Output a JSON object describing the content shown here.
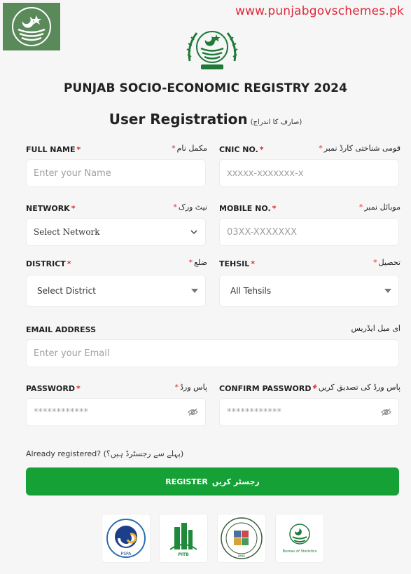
{
  "watermark": "www.punjabgovschemes.pk",
  "title": "PUNJAB SOCIO-ECONOMIC REGISTRY 2024",
  "subtitle": {
    "en": "User Registration",
    "ur": "(صارف کا اندراج)"
  },
  "fields": {
    "full_name": {
      "label": "FULL NAME",
      "label_ur": "مکمل نام",
      "placeholder": "Enter your Name"
    },
    "cnic": {
      "label": "CNIC NO.",
      "label_ur": "قومی شناختی کارڈ نمبر",
      "placeholder": "xxxxx-xxxxxxx-x"
    },
    "network": {
      "label": "NETWORK",
      "label_ur": "نیٹ ورک",
      "value": "Select Network"
    },
    "mobile": {
      "label": "MOBILE NO.",
      "label_ur": "موبائل نمبر",
      "placeholder": "03XX-XXXXXXX"
    },
    "district": {
      "label": "DISTRICT",
      "label_ur": "ضلع",
      "value": "Select District"
    },
    "tehsil": {
      "label": "TEHSIL",
      "label_ur": "تحصیل",
      "value": "All Tehsils"
    },
    "email": {
      "label": "EMAIL ADDRESS",
      "label_ur": "ای میل ایڈریس",
      "placeholder": "Enter your Email"
    },
    "password": {
      "label": "PASSWORD",
      "label_ur": "پاس ورڈ",
      "placeholder": "************"
    },
    "confirm_password": {
      "label": "CONFIRM PASSWORD",
      "label_ur": "پاس ورڈ کی تصدیق کریں",
      "placeholder": "************"
    }
  },
  "required_mark": "*",
  "already_registered": "Already registered? (پہلے سے رجسٹرڈ ہیں؟)",
  "register_button": {
    "en": "REGISTER",
    "ur": "رجسٹر کریں"
  },
  "partners": [
    "PSPA",
    "PITB",
    "PMIU",
    "Bureau of Statistics"
  ],
  "colors": {
    "accent": "#16a137",
    "required": "#d93030",
    "watermark": "#e0283a"
  }
}
